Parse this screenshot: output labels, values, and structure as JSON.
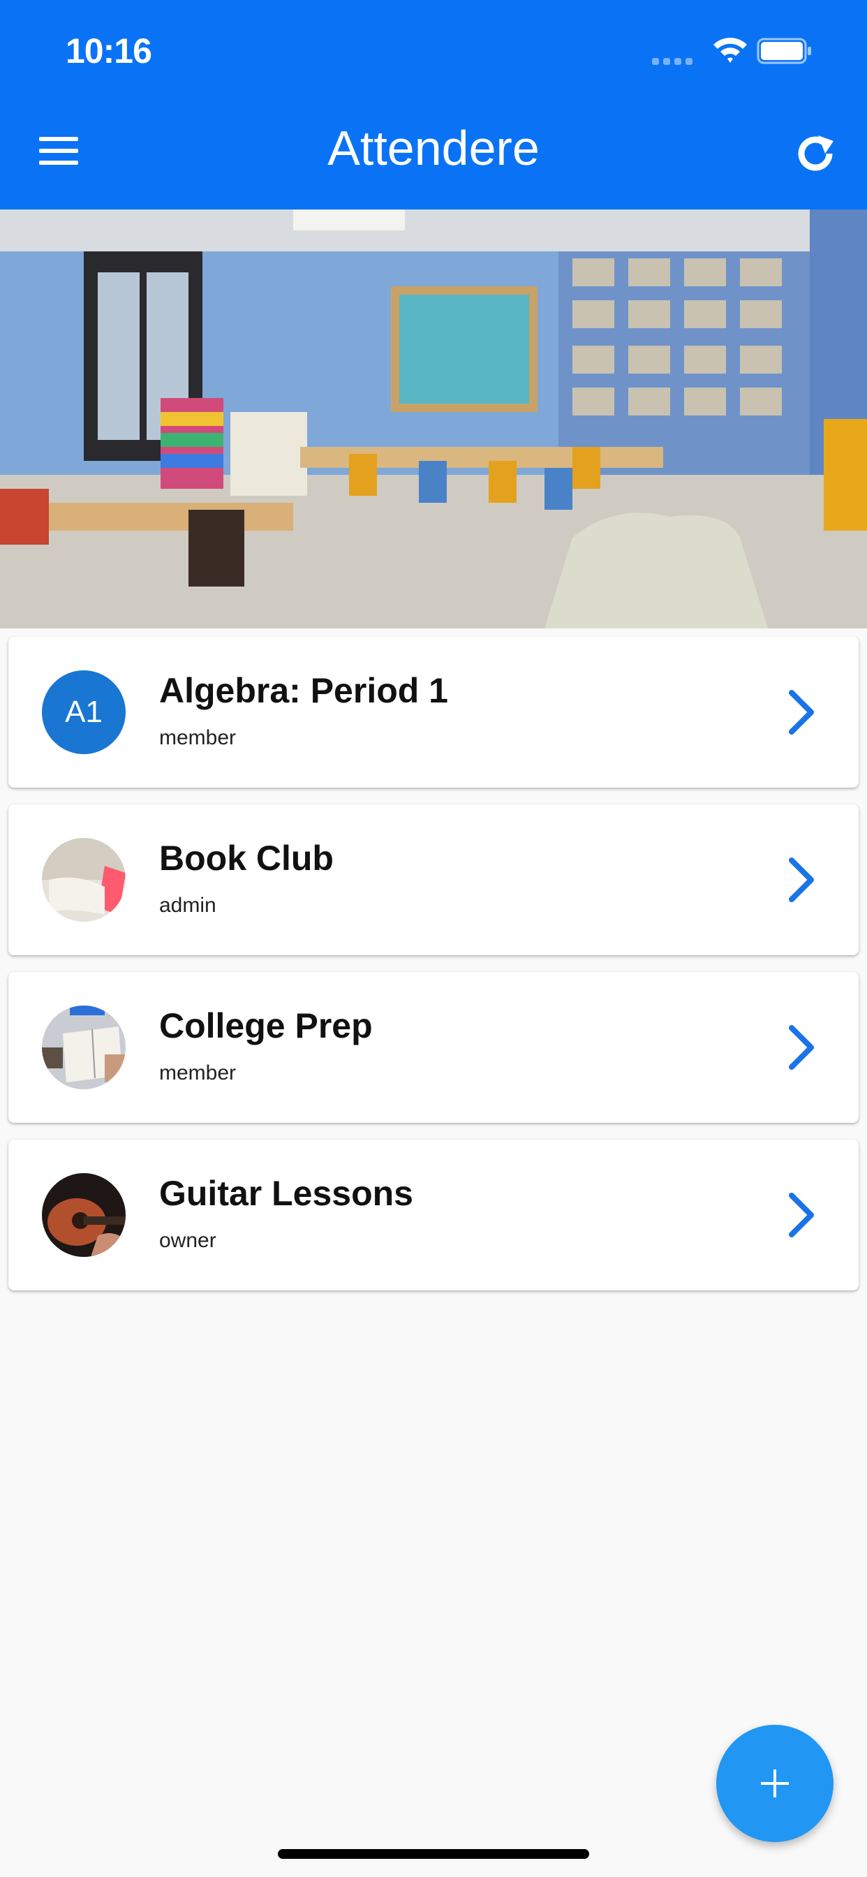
{
  "status_bar": {
    "time": "10:16"
  },
  "app_bar": {
    "title": "Attendere",
    "menu_icon": "hamburger-menu-icon",
    "refresh_icon": "refresh-icon"
  },
  "hero": {
    "description_icon": "classroom-photo"
  },
  "groups": [
    {
      "title": "Algebra: Period 1",
      "role": "member",
      "avatar_initials": "A1",
      "avatar_type": "initials"
    },
    {
      "title": "Book Club",
      "role": "admin",
      "avatar_type": "photo"
    },
    {
      "title": "College Prep",
      "role": "member",
      "avatar_type": "photo"
    },
    {
      "title": "Guitar Lessons",
      "role": "owner",
      "avatar_type": "photo"
    }
  ],
  "fab": {
    "icon": "plus-icon"
  },
  "colors": {
    "primary": "#0a73f5",
    "accent": "#2196f3",
    "avatar_initials_bg": "#1976d2",
    "chevron": "#1a73e8"
  }
}
